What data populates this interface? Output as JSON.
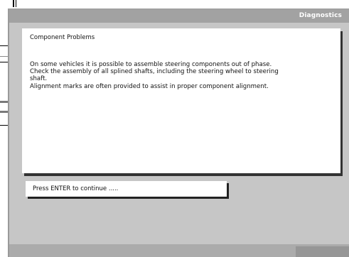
{
  "window": {
    "title": "Diagnostics"
  },
  "panel": {
    "heading": "Component Problems",
    "lines": [
      "On some vehicles it is possible to assemble steering components out of phase.",
      "Check the assembly of all splined shafts, including the steering wheel to steering",
      "shaft.",
      "Alignment marks are often provided to assist in proper component alignment."
    ]
  },
  "prompt": {
    "text": "Press ENTER to continue ....."
  },
  "colors": {
    "dialog_bg": "#c6c6c6",
    "titlebar_bg": "#a2a2a2",
    "statusbar_bg": "#ababab",
    "panel_bg": "#ffffff"
  }
}
